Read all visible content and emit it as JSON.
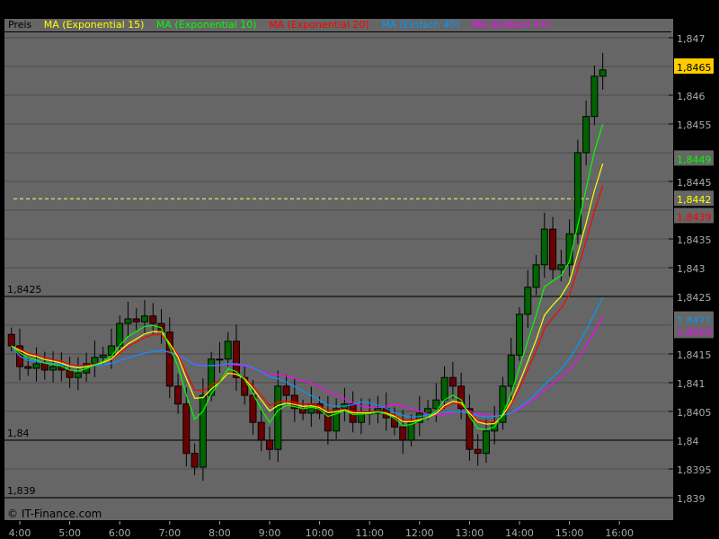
{
  "legend": [
    {
      "label": "Preis",
      "color": "#000000"
    },
    {
      "label": "MA (Exponential 15)",
      "color": "#ffff00"
    },
    {
      "label": "MA (Exponential 10)",
      "color": "#00ff00"
    },
    {
      "label": "MA (Exponential 20)",
      "color": "#ff0000"
    },
    {
      "label": "MA (Einfach 40)",
      "color": "#0099ff"
    },
    {
      "label": "MA (Einfach 47)",
      "color": "#ff00ff"
    }
  ],
  "watermark": "© IT-Finance.com",
  "chart_data": {
    "type": "candlestick",
    "x_start": "3:50",
    "interval_minutes": 10,
    "close": [
      1.84164,
      1.84128,
      1.84125,
      1.84133,
      1.84122,
      1.84128,
      1.84122,
      1.84109,
      1.84117,
      1.84133,
      1.84144,
      1.84148,
      1.84164,
      1.84203,
      1.84211,
      1.84206,
      1.84216,
      1.84203,
      1.84188,
      1.84094,
      1.84063,
      1.83977,
      1.83953,
      1.84078,
      1.84141,
      1.84141,
      1.84172,
      1.84109,
      1.84078,
      1.84031,
      1.84,
      1.83984,
      1.84094,
      1.84078,
      1.84055,
      1.84047,
      1.84063,
      1.84047,
      1.84016,
      1.84055,
      1.84063,
      1.84031,
      1.84047,
      1.84047,
      1.84055,
      1.84039,
      1.84023,
      1.84,
      1.84031,
      1.84047,
      1.84055,
      1.8407,
      1.84109,
      1.84094,
      1.84055,
      1.83984,
      1.83977,
      1.84016,
      1.84031,
      1.84094,
      1.84148,
      1.84219,
      1.84266,
      1.84305,
      1.84367,
      1.84297,
      1.84305,
      1.84359,
      1.845,
      1.84563,
      1.84633,
      1.84644
    ],
    "ylim": [
      1.8388,
      1.8474
    ],
    "y_ticks": [
      "1,847",
      "1,846",
      "1,8455",
      "1,8445",
      "1,8435",
      "1,843",
      "1,8425",
      "1,8415",
      "1,841",
      "1,8405",
      "1,84",
      "1,8395",
      "1,839"
    ],
    "y_tick_values": [
      1.847,
      1.846,
      1.8455,
      1.8445,
      1.8435,
      1.843,
      1.8425,
      1.8415,
      1.841,
      1.8405,
      1.84,
      1.8395,
      1.839
    ],
    "x_ticks": [
      "4:00",
      "5:00",
      "6:00",
      "7:00",
      "8:00",
      "9:00",
      "10:00",
      "11:00",
      "12:00",
      "13:00",
      "14:00",
      "15:00",
      "16:00"
    ],
    "left_levels": [
      {
        "label": "1,8425",
        "value": 1.8425
      },
      {
        "label": "1,84",
        "value": 1.84
      },
      {
        "label": "1,839",
        "value": 1.839
      }
    ],
    "dashed_level": 1.8442,
    "last_value_labels": [
      {
        "label": "1,8465",
        "value": 1.8465,
        "bg": "#ffcc00",
        "color": "#000000"
      },
      {
        "label": "1,8449",
        "value": 1.8449,
        "bg": "#666666",
        "color": "#00ff00"
      },
      {
        "label": "1,8442",
        "value": 1.8442,
        "bg": "#666666",
        "color": "#ffff00"
      },
      {
        "label": "1,8439",
        "value": 1.8439,
        "bg": "#666666",
        "color": "#ff0000"
      },
      {
        "label": "1,8421",
        "value": 1.8421,
        "bg": "#666666",
        "color": "#0099ff"
      },
      {
        "label": "1,8419",
        "value": 1.8419,
        "bg": "#666666",
        "color": "#ff00ff"
      }
    ],
    "colors": {
      "up": "#006400",
      "down": "#6b0000",
      "background": "#666666",
      "grid": "#555555"
    }
  }
}
